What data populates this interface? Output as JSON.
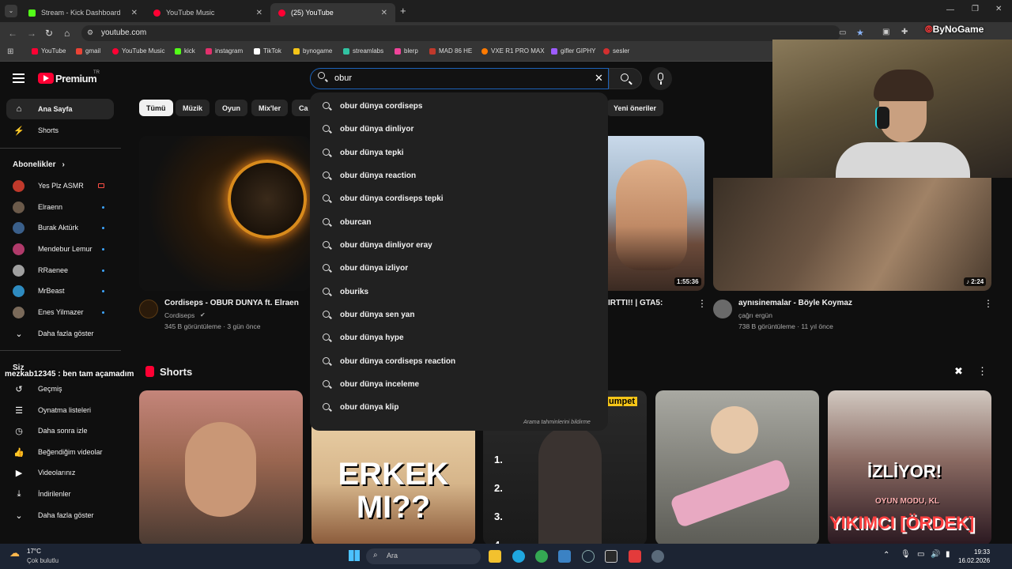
{
  "browser": {
    "tabs": [
      {
        "title": "Stream - Kick Dashboard",
        "color": "#53fc18"
      },
      {
        "title": "YouTube Music",
        "color": "#ff0033"
      },
      {
        "title": "(25) YouTube",
        "color": "#ff0033"
      }
    ],
    "url": "youtube.com",
    "bookmarks": [
      {
        "label": "YouTube",
        "color": "#ff0033"
      },
      {
        "label": "gmail",
        "color": "#ea4335"
      },
      {
        "label": "YouTube Music",
        "color": "#ff0033"
      },
      {
        "label": "kick",
        "color": "#53fc18"
      },
      {
        "label": "instagram",
        "color": "#e1306c"
      },
      {
        "label": "TikTok",
        "color": "#ffffff"
      },
      {
        "label": "bynogame",
        "color": "#f5c518"
      },
      {
        "label": "streamlabs",
        "color": "#31c3a2"
      },
      {
        "label": "blerp",
        "color": "#f0449a"
      },
      {
        "label": "MAD 86 HE",
        "color": "#c0392b"
      },
      {
        "label": "VXE R1 PRO MAX",
        "color": "#ff7a00"
      },
      {
        "label": "gifler GIPHY",
        "color": "#9d5cff"
      },
      {
        "label": "sesler",
        "color": "#d32f2f"
      }
    ],
    "profile_badge": "ByNoGame"
  },
  "header": {
    "logo_text": "Premium",
    "logo_region": "TR",
    "search_value": "obur"
  },
  "sidebar": {
    "main": [
      {
        "label": "Ana Sayfa",
        "icon": "home-icon"
      },
      {
        "label": "Shorts",
        "icon": "shorts-icon"
      }
    ],
    "subscriptions_title": "Abonelikler",
    "subscriptions": [
      {
        "label": "Yes Plz ASMR",
        "color": "#c0392b",
        "indicator": "live"
      },
      {
        "label": "Elraenn",
        "color": "#6b5a4a",
        "indicator": "dot"
      },
      {
        "label": "Burak Aktürk",
        "color": "#3a5f8a",
        "indicator": "dot"
      },
      {
        "label": "Mendebur Lemur",
        "color": "#b03a6a",
        "indicator": "dot"
      },
      {
        "label": "RRaenee",
        "color": "#a0a0a0",
        "indicator": "dot"
      },
      {
        "label": "MrBeast",
        "color": "#2e8bc0",
        "indicator": "dot"
      },
      {
        "label": "Enes Yilmazer",
        "color": "#7a6a5a",
        "indicator": "dot"
      }
    ],
    "show_more": "Daha fazla göster",
    "you_title": "Siz",
    "you_items": [
      {
        "label": "Geçmiş",
        "icon": "history-icon"
      },
      {
        "label": "Oynatma listeleri",
        "icon": "playlist-icon"
      },
      {
        "label": "Daha sonra izle",
        "icon": "clock-icon"
      },
      {
        "label": "Beğendiğim videolar",
        "icon": "thumbs-up-icon"
      },
      {
        "label": "Videolarınız",
        "icon": "video-icon"
      },
      {
        "label": "İndirilenler",
        "icon": "download-icon"
      }
    ],
    "show_more_2": "Daha fazla göster"
  },
  "chips": [
    "Tümü",
    "Müzik",
    "Oyun",
    "Mix'ler",
    "Ca",
    "Yeni öneriler"
  ],
  "videos": [
    {
      "title": "Cordiseps - OBUR DUNYA ft. Elraen",
      "channel": "Cordiseps",
      "meta": "345 B görüntüleme · 3 gün önce"
    },
    {
      "title": "IRTTI!! | GTA5:",
      "duration": "1:55:36"
    },
    {
      "title": "aynısinemalar - Böyle Koymaz",
      "channel": "çağrı ergün",
      "meta": "738 B görüntüleme · 11 yıl önce",
      "duration": "2:24"
    }
  ],
  "shorts": {
    "title": "Shorts",
    "overlay_texts": [
      "ERKEK",
      "MI??",
      "umpet",
      "İZLİYOR!",
      "OYUN MODU, KL",
      "YIKIMCI [ÖRDEK]"
    ]
  },
  "suggestions": [
    "obur dünya cordiseps",
    "obur dünya dinliyor",
    "obur dünya tepki",
    "obur dünya reaction",
    "obur dünya cordiseps tepki",
    "oburcan",
    "obur dünya dinliyor eray",
    "obur dünya izliyor",
    "oburiks",
    "obur dünya sen yan",
    "obur dünya hype",
    "obur dünya cordiseps reaction",
    "obur dünya inceleme",
    "obur dünya klip"
  ],
  "suggestions_report": "Arama tahminlerini bildirme",
  "chat": {
    "user": "mezkab12345",
    "message": "ben tam açamadım"
  },
  "taskbar": {
    "weather_temp": "17°C",
    "weather_desc": "Çok bulutlu",
    "search_placeholder": "Ara",
    "time": "19:33",
    "date": "16.02.2026"
  }
}
